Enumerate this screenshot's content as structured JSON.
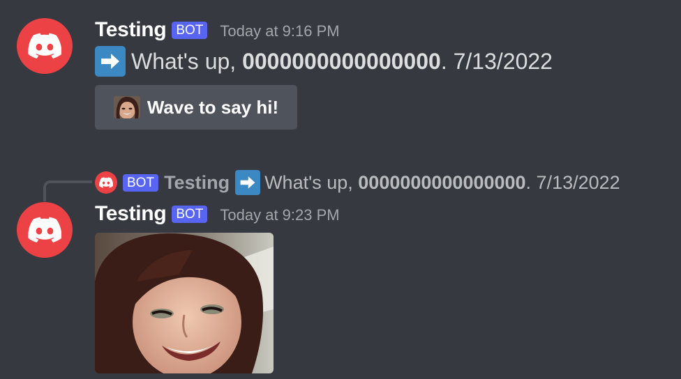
{
  "colors": {
    "background": "#36393f",
    "avatar_red": "#ed4245",
    "bot_tag": "#5865f2",
    "arrow_blue": "#3b88c3",
    "button_bg": "#4f545c"
  },
  "messages": [
    {
      "avatar_icon": "discord-logo-icon",
      "username": "Testing",
      "bot_tag": "BOT",
      "timestamp": "Today at 9:16 PM",
      "text_prefix": "What's up, ",
      "text_bold": "0000000000000000",
      "text_suffix": ". 7/13/2022",
      "button": {
        "icon": "face-emoji-icon",
        "label": "Wave to say hi!"
      }
    },
    {
      "avatar_icon": "discord-logo-icon",
      "reply": {
        "bot_tag": "BOT",
        "username": "Testing",
        "text_prefix": "What's up, ",
        "text_bold": "0000000000000000",
        "text_suffix": ". 7/13/2022"
      },
      "username": "Testing",
      "bot_tag": "BOT",
      "timestamp": "Today at 9:23 PM",
      "attachment": {
        "type": "gif",
        "icon": "smiling-woman-image"
      }
    }
  ]
}
